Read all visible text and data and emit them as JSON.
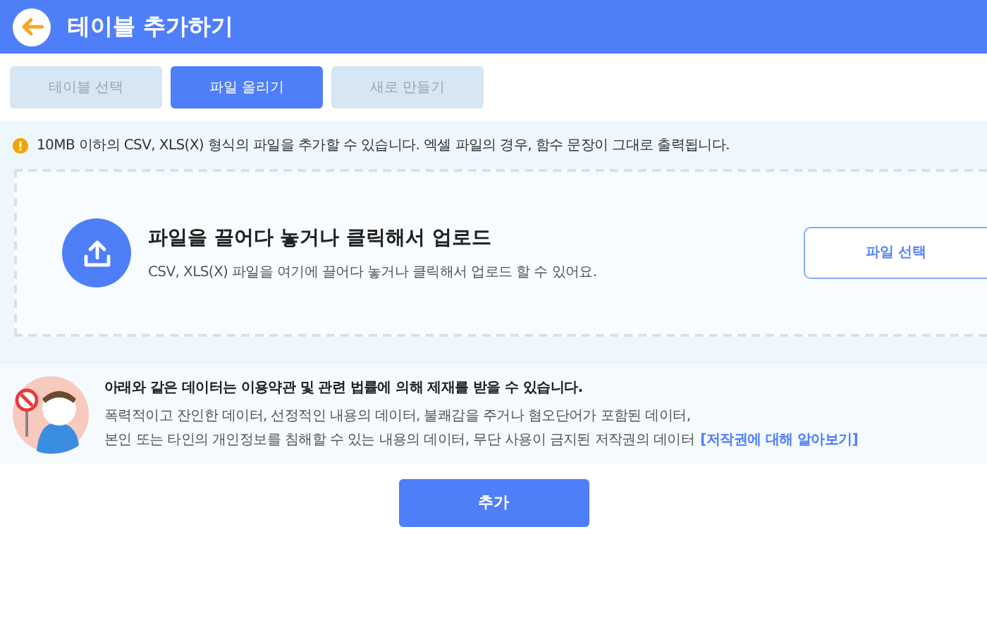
{
  "header": {
    "title": "테이블 추가하기"
  },
  "tabs": [
    {
      "label": "테이블 선택",
      "selected": false
    },
    {
      "label": "파일 올리기",
      "selected": true
    },
    {
      "label": "새로 만들기",
      "selected": false
    }
  ],
  "notice": "10MB 이하의 CSV, XLS(X) 형식의 파일을 추가할 수 있습니다. 엑셀 파일의 경우, 함수 문장이 그대로 출력됩니다.",
  "dropzone": {
    "title": "파일을 끌어다 놓거나 클릭해서 업로드",
    "subtitle": "CSV, XLS(X) 파일을 여기에 끌어다 놓거나 클릭해서 업로드 할 수 있어요.",
    "button": "파일 선택"
  },
  "warning": {
    "title": "아래와 같은 데이터는 이용약관 및 관련 법률에 의해 제재를 받을 수 있습니다.",
    "lines": [
      "폭력적이고 잔인한 데이터, 선정적인 내용의 데이터, 불쾌감을 주거나 혐오단어가 포함된 데이터,",
      "본인 또는 타인의 개인정보를 침해할 수 있는 내용의 데이터, 무단 사용이 금지된 저작권의 데이터"
    ],
    "link": "[저작권에 대해 알아보기]"
  },
  "submit": "추가"
}
